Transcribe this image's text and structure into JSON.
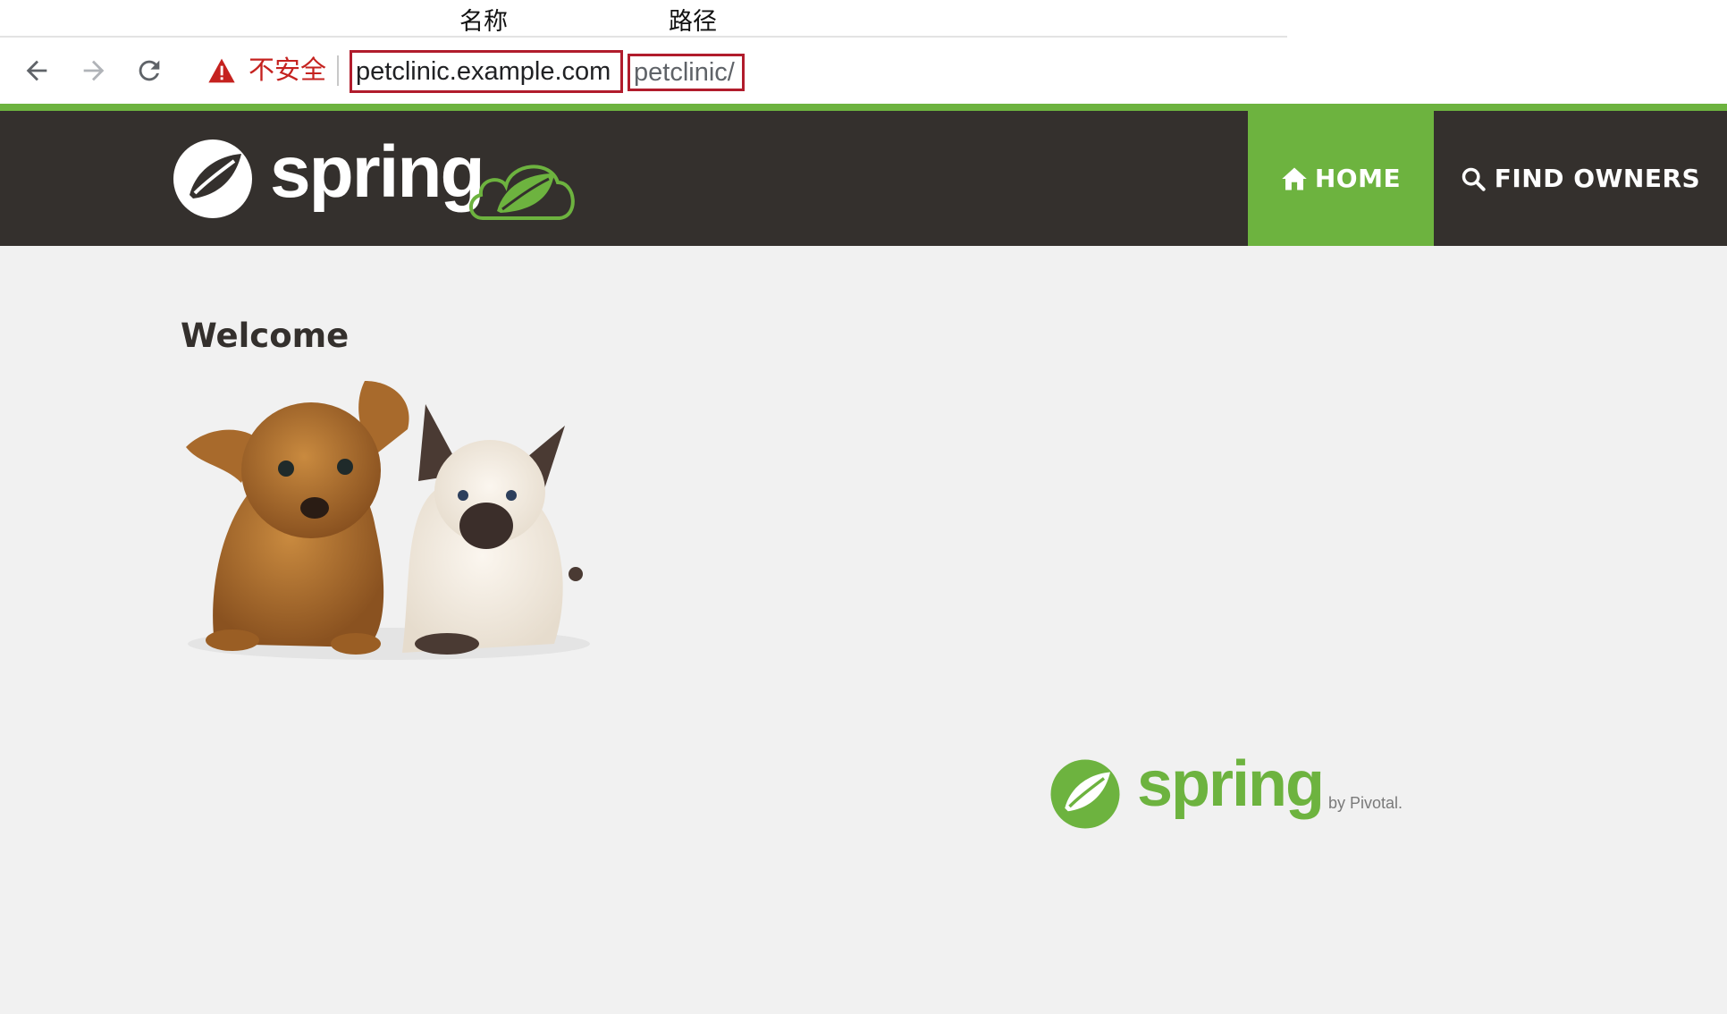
{
  "annotations": {
    "name_label": "名称",
    "path_label": "路径"
  },
  "browser": {
    "security_label": "不安全",
    "url_host": "petclinic.example.com",
    "url_path": "petclinic/",
    "colors": {
      "warning": "#c5221f",
      "highlight_box": "#b11c2c"
    }
  },
  "navbar": {
    "brand_text": "spring",
    "items": [
      {
        "label": "HOME",
        "icon": "home-icon",
        "active": true
      },
      {
        "label": "FIND OWNERS",
        "icon": "search-icon",
        "active": false
      }
    ],
    "colors": {
      "background": "#34302d",
      "accent": "#6db33f"
    }
  },
  "main": {
    "heading": "Welcome",
    "image_icon": "pets-image"
  },
  "footer": {
    "brand_text": "spring",
    "byline": "by Pivotal."
  }
}
